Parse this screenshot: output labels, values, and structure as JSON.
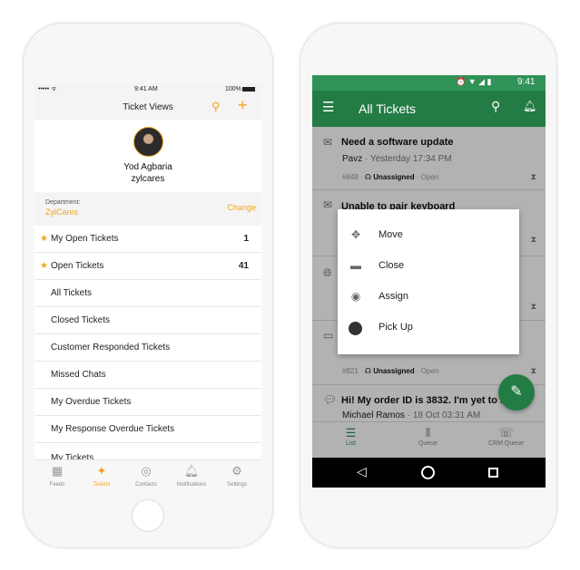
{
  "ios": {
    "status": {
      "time": "9:41 AM",
      "battery": "100%"
    },
    "nav": {
      "title": "Ticket Views"
    },
    "profile": {
      "name": "Yod Agbaria",
      "org": "zylcares"
    },
    "department": {
      "label": "Department:",
      "value": "ZylCares",
      "change": "Change"
    },
    "views": [
      {
        "label": "My Open Tickets",
        "count": "1",
        "starred": true
      },
      {
        "label": "Open Tickets",
        "count": "41",
        "starred": true
      },
      {
        "label": "All Tickets"
      },
      {
        "label": "Closed Tickets"
      },
      {
        "label": "Customer Responded Tickets"
      },
      {
        "label": "Missed Chats"
      },
      {
        "label": "My Overdue Tickets"
      },
      {
        "label": "My Response Overdue Tickets"
      },
      {
        "label": "My Tickets"
      }
    ],
    "tabs": [
      {
        "label": "Feeds"
      },
      {
        "label": "Tickets",
        "active": true
      },
      {
        "label": "Contacts"
      },
      {
        "label": "Notifications"
      },
      {
        "label": "Settings"
      }
    ],
    "accent": "#f2a51a"
  },
  "android": {
    "status": {
      "time": "9:41"
    },
    "toolbar": {
      "title": "All Tickets"
    },
    "tickets": [
      {
        "title": "Need a software update",
        "from": "Pavz",
        "time": "Yesterday 17:34 PM",
        "id": "#848",
        "assignee": "Unassigned",
        "status": "Open",
        "channel": "email"
      },
      {
        "title": "Unable to pair keyboard",
        "channel": "email"
      },
      {
        "channel": "web"
      },
      {
        "id": "#821",
        "assignee": "Unassigned",
        "status": "Open",
        "channel": "chat"
      },
      {
        "title": "Hi! My order ID is 3832. I'm yet to r",
        "from": "Michael Ramos",
        "time": "18 Oct 03:31 AM",
        "channel": "chat"
      }
    ],
    "menu": [
      {
        "label": "Move",
        "icon": "move-icon"
      },
      {
        "label": "Close",
        "icon": "ticket-close-icon"
      },
      {
        "label": "Assign",
        "icon": "assign-icon"
      },
      {
        "label": "Pick Up",
        "icon": "avatar"
      }
    ],
    "tabs": [
      {
        "label": "List",
        "active": true
      },
      {
        "label": "Queue"
      },
      {
        "label": "CRM Queue"
      }
    ],
    "accent": "#2e8b4e"
  }
}
